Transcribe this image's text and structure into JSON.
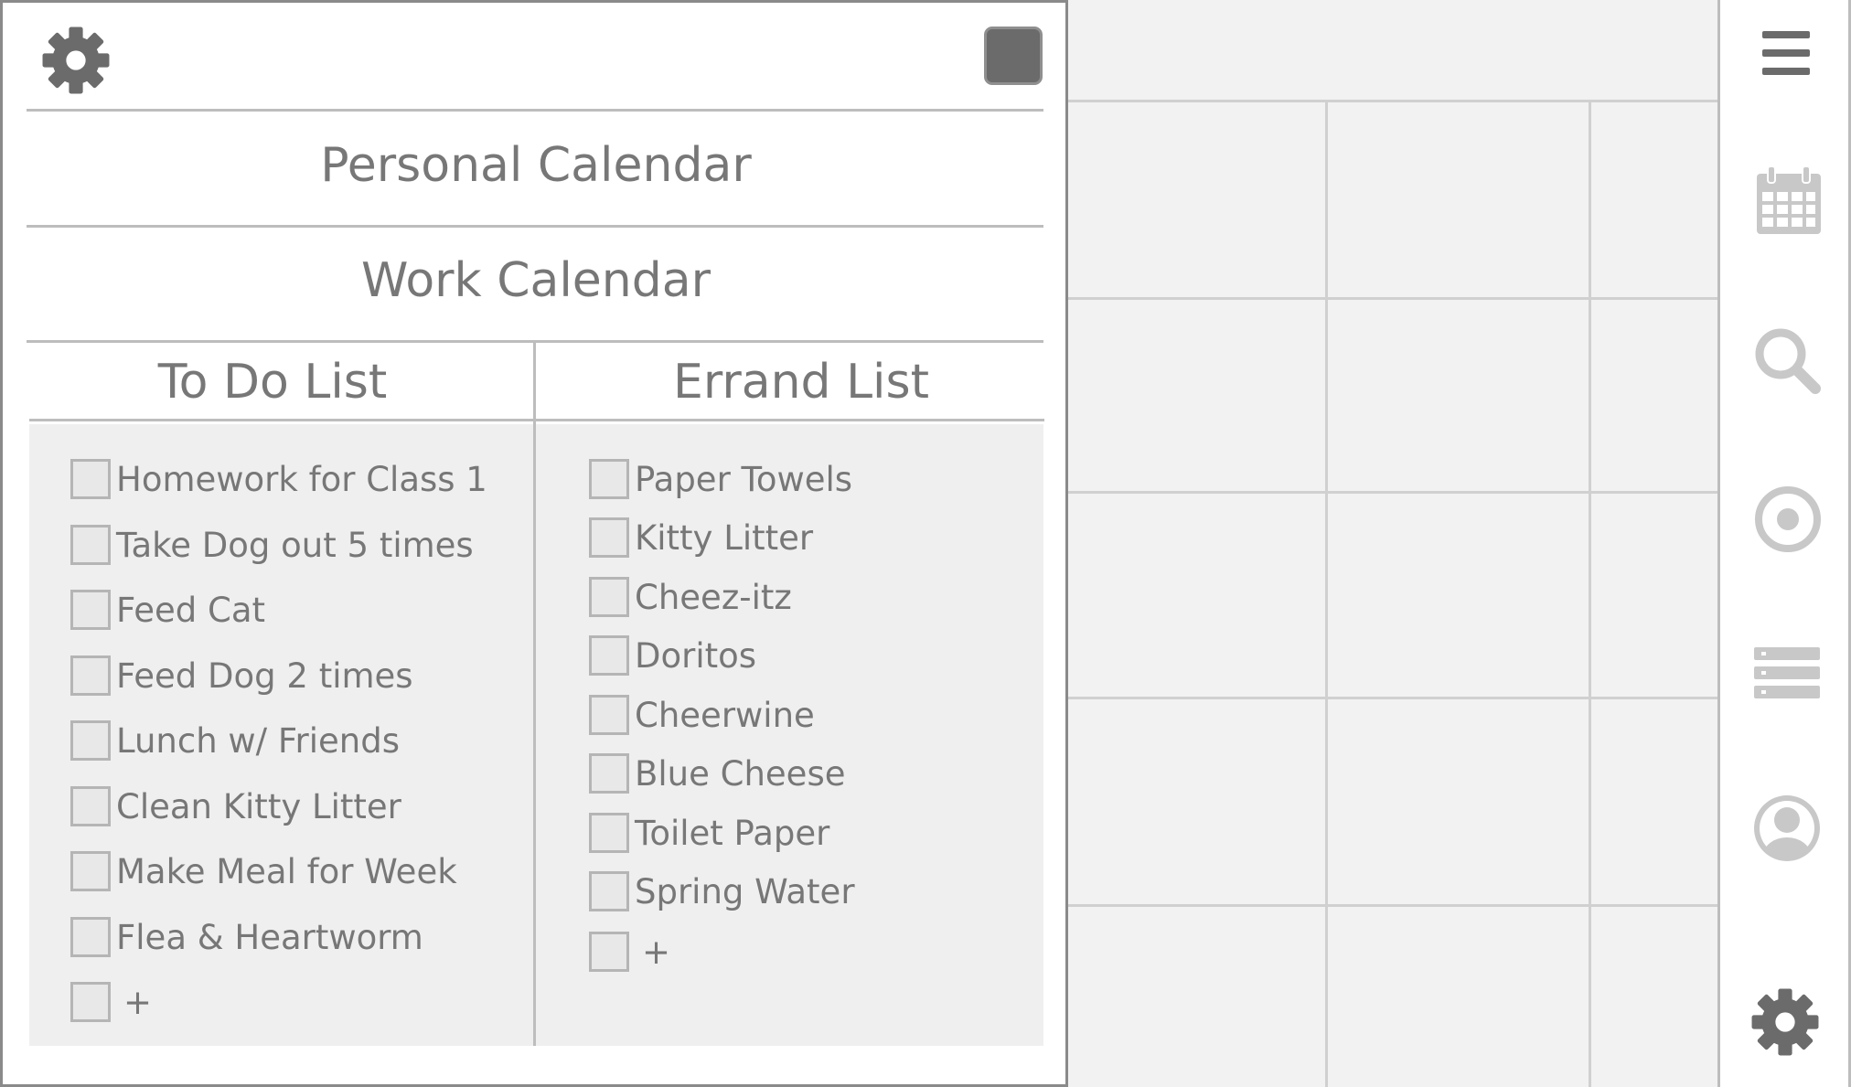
{
  "panel": {
    "calendars": [
      "Personal Calendar",
      "Work Calendar"
    ],
    "todo": {
      "title": "To Do List",
      "items": [
        "Homework for Class 1",
        "Take Dog out 5 times",
        "Feed Cat",
        "Feed Dog 2 times",
        "Lunch w/ Friends",
        "Clean Kitty Litter",
        "Make Meal for Week",
        "Flea & Heartworm"
      ],
      "add_label": "+"
    },
    "errand": {
      "title": "Errand List",
      "items": [
        "Paper Towels",
        "Kitty Litter",
        "Cheez-itz",
        "Doritos",
        "Cheerwine",
        "Blue Cheese",
        "Toilet Paper",
        "Spring Water"
      ],
      "add_label": "+"
    }
  },
  "sidebar": {
    "icons": [
      "menu-icon",
      "calendar-icon",
      "search-icon",
      "target-icon",
      "list-icon",
      "user-icon",
      "gear-icon"
    ]
  },
  "colors": {
    "panel_bg": "#ffffff",
    "list_bg": "#efefef",
    "grid_bg": "#f2f2f2",
    "icon_dark": "#6b6b6b",
    "icon_light": "#c8c8c8",
    "text": "#777777"
  }
}
